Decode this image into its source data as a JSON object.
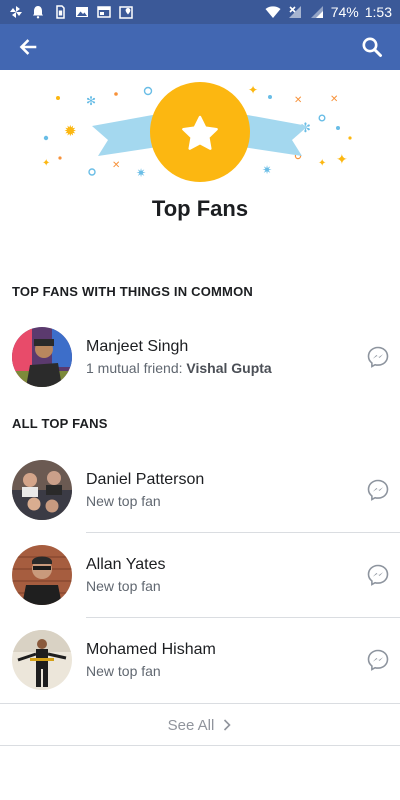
{
  "status_bar": {
    "battery": "74%",
    "time": "1:53"
  },
  "nav": {
    "back_icon": "back-arrow-icon",
    "search_icon": "search-icon"
  },
  "hero": {
    "title": "Top Fans",
    "badge_icon": "star-icon",
    "colors": {
      "badge": "#fcb711",
      "ribbon": "#a4d8ef",
      "ribbon_dark": "#7fc2e0",
      "nav": "#4267b2",
      "status": "#3b5998"
    }
  },
  "common_section": {
    "heading": "TOP FANS WITH THINGS IN COMMON",
    "items": [
      {
        "name": "Manjeet Singh",
        "sub_prefix": "1 mutual friend: ",
        "sub_bold": "Vishal Gupta"
      }
    ]
  },
  "all_section": {
    "heading": "ALL TOP FANS",
    "items": [
      {
        "name": "Daniel Patterson",
        "sub": "New top fan"
      },
      {
        "name": "Allan Yates",
        "sub": "New top fan"
      },
      {
        "name": "Mohamed Hisham",
        "sub": "New top fan"
      }
    ]
  },
  "see_all": {
    "label": "See All"
  }
}
